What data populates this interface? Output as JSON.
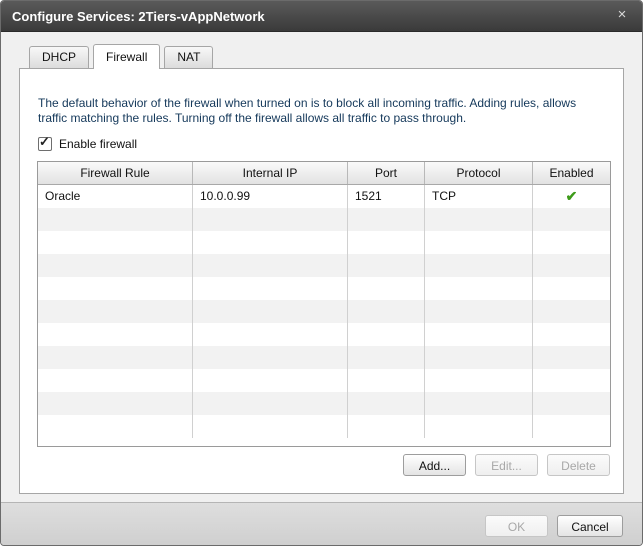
{
  "window": {
    "title": "Configure Services: 2Tiers-vAppNetwork",
    "close_icon": "×"
  },
  "tabs": [
    {
      "label": "DHCP",
      "active": false
    },
    {
      "label": "Firewall",
      "active": true
    },
    {
      "label": "NAT",
      "active": false
    }
  ],
  "firewall": {
    "description": "The default behavior of the firewall when turned on is to block all incoming traffic. Adding rules, allows traffic matching the rules. Turning off the firewall allows all traffic to pass through.",
    "enable_label": "Enable firewall",
    "enabled": true,
    "columns": [
      "Firewall Rule",
      "Internal IP",
      "Port",
      "Protocol",
      "Enabled"
    ],
    "rows": [
      {
        "rule": "Oracle",
        "ip": "10.0.0.99",
        "port": "1521",
        "protocol": "TCP",
        "enabled": "✔"
      }
    ],
    "buttons": {
      "add": "Add...",
      "edit": "Edit...",
      "delete": "Delete"
    }
  },
  "footer": {
    "ok": "OK",
    "cancel": "Cancel"
  },
  "colors": {
    "check": "#3e9b1a",
    "titlebar": "#4a4a4a"
  }
}
